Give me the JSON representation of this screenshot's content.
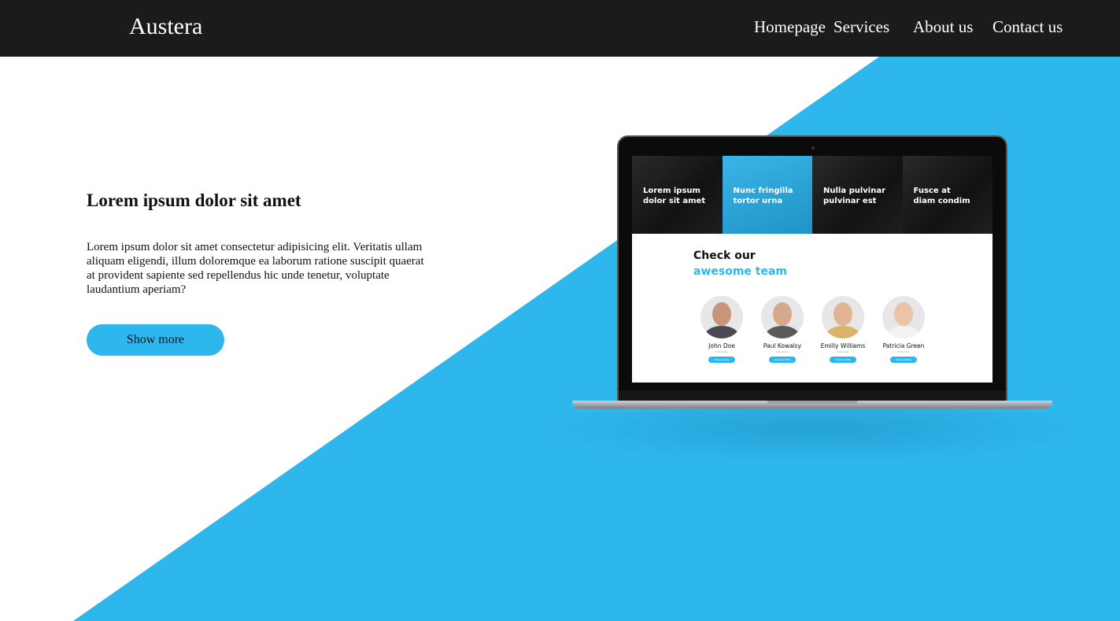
{
  "colors": {
    "accent": "#2eb7ec",
    "navbar": "#1b1b1b"
  },
  "navbar": {
    "brand": "Austera",
    "links": [
      "Homepage",
      "Services",
      "About us",
      "Contact us"
    ]
  },
  "hero": {
    "title": "Lorem ipsum dolor sit amet",
    "text": "Lorem ipsum dolor sit amet consectetur adipisicing elit. Veritatis ullam aliquam eligendi, illum doloremque ea laborum ratione suscipit quaerat at provident sapiente sed repellendus hic unde tenetur, voluptate laudantium aperiam?",
    "button": "Show more"
  },
  "laptop_screen": {
    "tiles": [
      "Lorem ipsum\ndolor sit amet",
      "Nunc fringilla\ntortor urna",
      "Nulla pulvinar\npulvinar est",
      "Fusce at\ndiam condim"
    ],
    "heading_line1": "Check our",
    "heading_line2": "awesome team",
    "members": [
      {
        "name": "John Doe",
        "role": "Cofounder",
        "button": "Check profile"
      },
      {
        "name": "Paul Kowalsy",
        "role": "Cofounder",
        "button": "Check profile"
      },
      {
        "name": "Emilly Williams",
        "role": "Cofounder",
        "button": "Check profile"
      },
      {
        "name": "Patricia Green",
        "role": "Cofounder",
        "button": "Check profile"
      }
    ]
  }
}
